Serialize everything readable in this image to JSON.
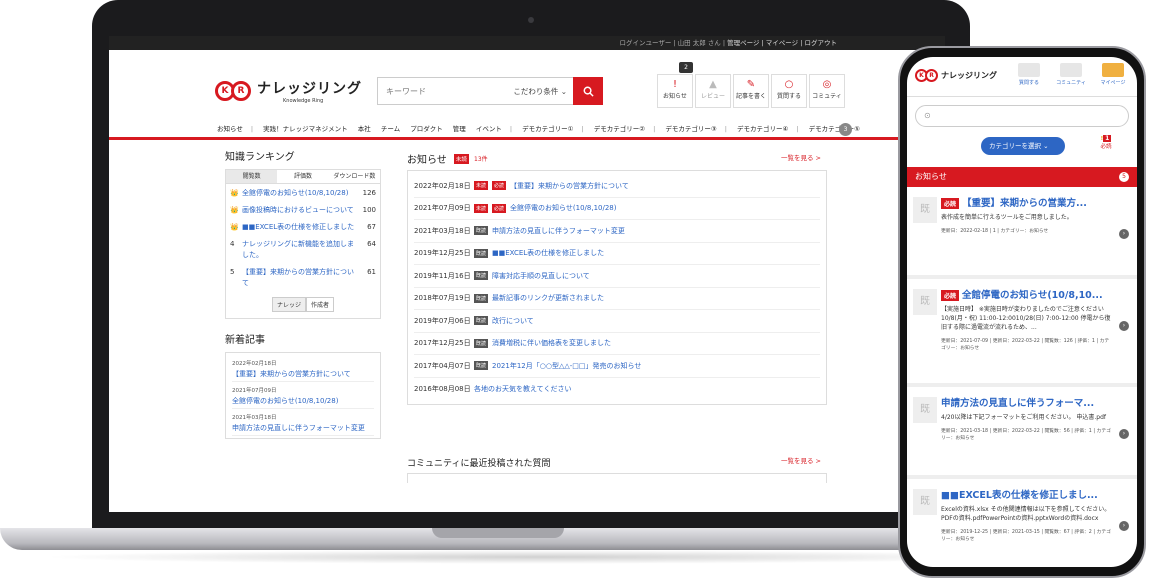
{
  "desktop": {
    "topbar": {
      "user_text": "ログインユーザー | 山田 太郎 さん | ",
      "links": "管理ページ | マイページ | ログアウト"
    },
    "logo": {
      "main": "ナレッジリング",
      "sub": "Knowledge Ring"
    },
    "search": {
      "placeholder": "キーワード",
      "condition": "こだわり条件",
      "button_icon": "search-icon"
    },
    "header_icons": [
      {
        "label": "お知らせ",
        "icon": "bell-exclamation-icon",
        "badge": "2"
      },
      {
        "label": "レビュー",
        "icon": "bell-icon"
      },
      {
        "label": "記事を書く",
        "icon": "pen-icon"
      },
      {
        "label": "質問する",
        "icon": "speech-bubble-icon"
      },
      {
        "label": "コミュティ",
        "icon": "chat-icon"
      }
    ],
    "nav": [
      "お知らせ",
      "実践！ナレッジマネジメント",
      "本社",
      "チーム",
      "プロダクト",
      "管理",
      "イベント",
      "デモカテゴリー①",
      "デモカテゴリー②",
      "デモカテゴリー③",
      "デモカテゴリー④",
      "デモカテゴリー⑤"
    ],
    "nav_count": "3",
    "ranking": {
      "title": "知識ランキング",
      "tabs": [
        "閲覧数",
        "評価数",
        "ダウンロード数"
      ],
      "items": [
        {
          "rank": "👑",
          "title": "全館停電のお知らせ(10/8,10/28)",
          "count": "126"
        },
        {
          "rank": "👑",
          "title": "画像投稿時におけるビューについて",
          "count": "100"
        },
        {
          "rank": "👑",
          "title": "■■EXCEL表の仕様を修正しました",
          "count": "67"
        },
        {
          "rank": "4",
          "title": "ナレッジリングに新機能を追加しました。",
          "count": "64"
        },
        {
          "rank": "5",
          "title": "【重要】来期からの営業方針について",
          "count": "61"
        }
      ],
      "switch": [
        "ナレッジ",
        "作成者"
      ]
    },
    "new_posts": {
      "title": "新着記事",
      "items": [
        {
          "date": "2022年02月18日",
          "title": "【重要】来期からの営業方針について"
        },
        {
          "date": "2021年07月09日",
          "title": "全館停電のお知らせ(10/8,10/28)"
        },
        {
          "date": "2021年03月18日",
          "title": "申請方法の見直しに伴うフォーマット変更"
        }
      ]
    },
    "news": {
      "title": "お知らせ",
      "unread_label": "未読",
      "unread_count": "13件",
      "more": "一覧を見る >",
      "items": [
        {
          "date": "2022年02月18日",
          "tags": [
            "未読",
            "必読"
          ],
          "title": "【重要】来期からの営業方針について"
        },
        {
          "date": "2021年07月09日",
          "tags": [
            "未読",
            "必読"
          ],
          "title": "全館停電のお知らせ(10/8,10/28)"
        },
        {
          "date": "2021年03月18日",
          "tags": [
            "既読"
          ],
          "title": "申請方法の見直しに伴うフォーマット変更"
        },
        {
          "date": "2019年12月25日",
          "tags": [
            "既読"
          ],
          "title": "■■EXCEL表の仕様を修正しました"
        },
        {
          "date": "2019年11月16日",
          "tags": [
            "既読"
          ],
          "title": "障害対応手順の見直しについて"
        },
        {
          "date": "2018年07月19日",
          "tags": [
            "既読"
          ],
          "title": "最新記事のリンクが更新されました"
        },
        {
          "date": "2019年07月06日",
          "tags": [
            "既読"
          ],
          "title": "改行について"
        },
        {
          "date": "2017年12月25日",
          "tags": [
            "既読"
          ],
          "title": "消費増税に伴い価格表を変更しました"
        },
        {
          "date": "2017年04月07日",
          "tags": [
            "既読"
          ],
          "title": "2021年12月「○○型△△-□□」発売のお知らせ"
        },
        {
          "date": "2016年08月08日",
          "tags": [
            "既読"
          ],
          "title": "各地のお天気を教えてください"
        }
      ]
    },
    "community": {
      "title": "コミュニティに最近投稿された質問",
      "more": "一覧を見る >"
    }
  },
  "mobile": {
    "logo": "ナレッジリング",
    "top_links": [
      "質問する",
      "コミュニティ",
      "マイページ"
    ],
    "search_icon": "search-icon",
    "category_button": "カテゴリーを選択",
    "must_read": {
      "label": "必読",
      "count": "1"
    },
    "news_title": "お知らせ",
    "news_count": "5",
    "items": [
      {
        "must": "必読",
        "title": "【重要】来期からの営業方...",
        "body": "表作成を簡単に行えるツールをご用意しました。",
        "meta": "更新日：2022-02-18 | 1 | カテゴリー：お知らせ"
      },
      {
        "must": "必読",
        "title": "全館停電のお知らせ(10/8,10...",
        "body": "【実施日時】 ※実施日時が変わりましたのでご注意ください10/8(月・祝) 11:00-12:0010/28(日) 7:00-12:00 停電から復旧する際に過電流が流れるため、...",
        "meta": "更新日：2021-07-09 | 更新日：2022-03-22 | 閲覧数：126 | 評価：1 | カテゴリー：お知らせ"
      },
      {
        "must": "",
        "title": "申請方法の見直しに伴うフォーマ...",
        "body": "4/20以降は下記フォーマットをご利用ください。 申込書.pdf",
        "meta": "更新日：2021-03-18 | 更新日：2022-03-22 | 閲覧数：56 | 評価：1 | カテゴリー：お知らせ"
      },
      {
        "must": "",
        "title": "■■EXCEL表の仕様を修正しまし...",
        "body": "Excelの資料.xlsx その他関連情報は以下を参照してください。 PDFの資料.pdfPowerPointの資料.pptxWordの資料.docx",
        "meta": "更新日：2019-12-25 | 更新日：2021-03-15 | 閲覧数：67 | 評価：2 | カテゴリー：お知らせ"
      }
    ]
  }
}
